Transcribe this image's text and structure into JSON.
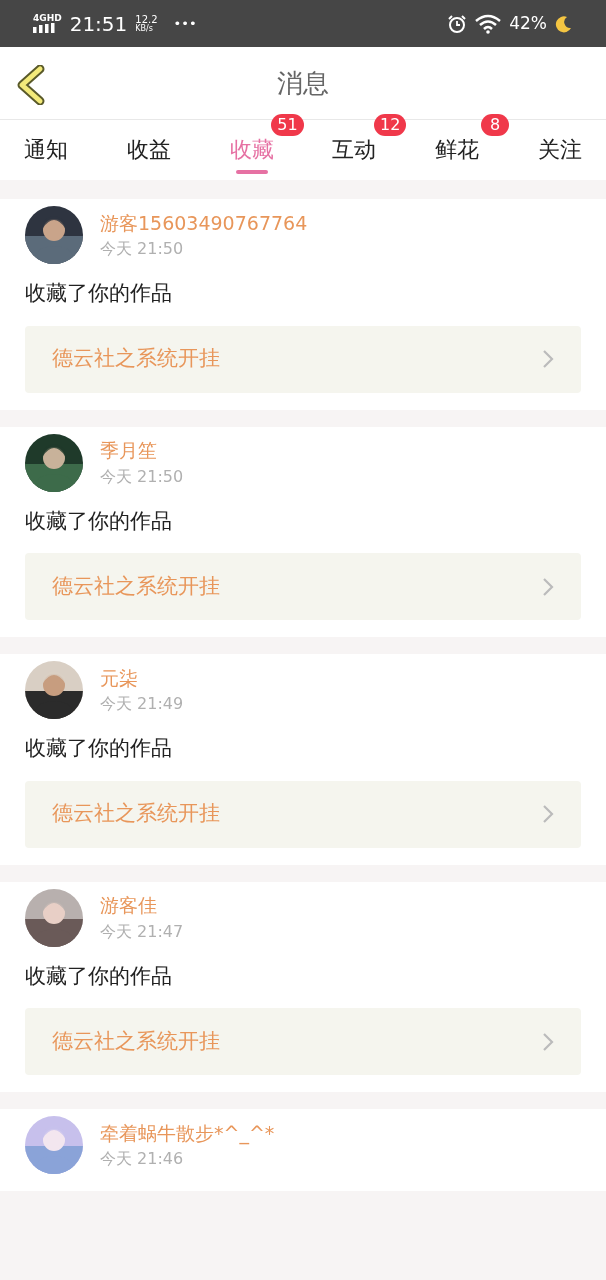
{
  "status_bar": {
    "network": "4GHD",
    "time": "21:51",
    "speed": "12.2",
    "speed_unit": "KB/s",
    "more": "•••",
    "battery": "42%"
  },
  "header": {
    "title": "消息"
  },
  "tabs": [
    {
      "label": "通知",
      "selected": false
    },
    {
      "label": "收益",
      "selected": false
    },
    {
      "label": "收藏",
      "selected": true,
      "badge": "51"
    },
    {
      "label": "互动",
      "selected": false,
      "badge": "12"
    },
    {
      "label": "鲜花",
      "selected": false,
      "badge": "8"
    },
    {
      "label": "关注",
      "selected": false
    }
  ],
  "messages": [
    {
      "name": "游客15603490767764",
      "time": "今天 21:50",
      "action": "收藏了你的作品",
      "work": "德云社之系统开挂"
    },
    {
      "name": "季月笙",
      "time": "今天 21:50",
      "action": "收藏了你的作品",
      "work": "德云社之系统开挂"
    },
    {
      "name": "元柒",
      "time": "今天 21:49",
      "action": "收藏了你的作品",
      "work": "德云社之系统开挂"
    },
    {
      "name": "游客佳",
      "time": "今天 21:47",
      "action": "收藏了你的作品",
      "work": "德云社之系统开挂"
    },
    {
      "name": "牵着蜗牛散步*^_^*",
      "time": "今天 21:46"
    }
  ]
}
